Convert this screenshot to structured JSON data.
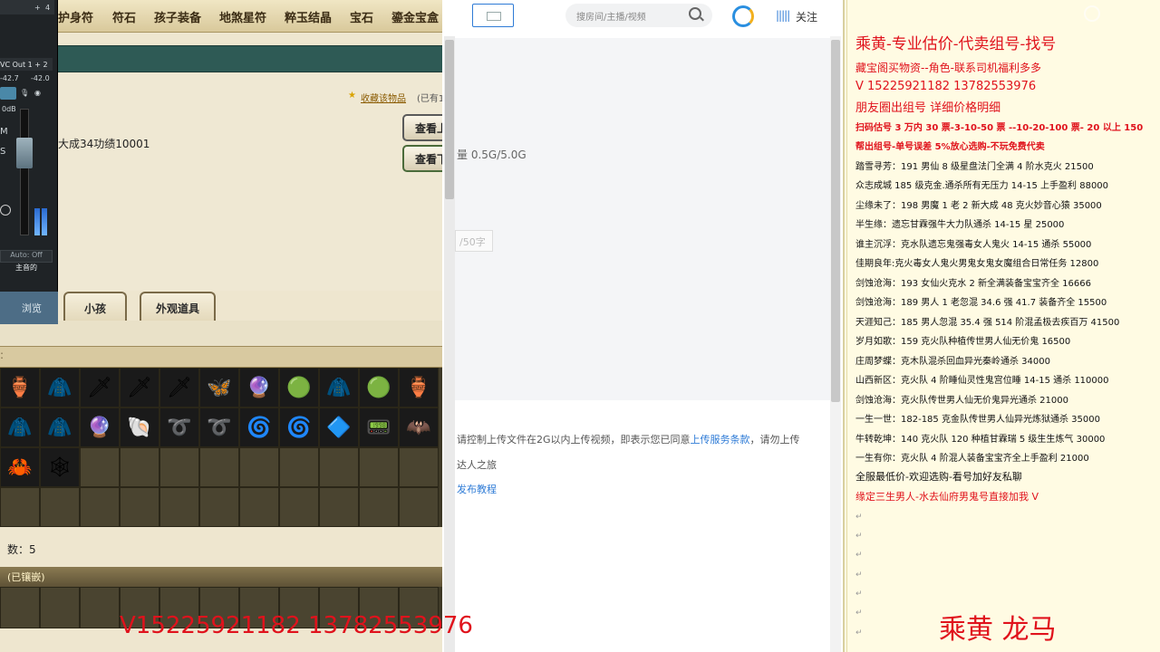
{
  "game": {
    "tabs": [
      "护身符",
      "符石",
      "孩子装备",
      "地煞星符",
      "粹玉结晶",
      "宝石",
      "鎏金宝盒"
    ],
    "favorite_link": "收藏该物品",
    "favorite_count": "(已有1",
    "achievement": "大成34功绩10001",
    "view_buttons": [
      "查看上",
      "查看下"
    ],
    "subtabs": [
      "小孩",
      "外观道具"
    ],
    "items_row1": [
      "🏺",
      "🧥",
      "🗡",
      "🗡",
      "🗡",
      "🦋",
      "🔮",
      "🟢",
      "🧥",
      "🟢",
      "🏺"
    ],
    "items_row2": [
      "🧥",
      "🧥",
      "🔮",
      "🐚",
      "➰",
      "➰",
      "🌀",
      "🌀",
      "🔷",
      "📟",
      "🦇"
    ],
    "items_row3": [
      "🦀",
      "🕸"
    ],
    "stones_label": "数：5",
    "gem_header": "(已镶嵌)"
  },
  "mixer": {
    "top_label": "+",
    "top_value": "4",
    "output": "VC Out 1 + 2",
    "db1": "-42.7",
    "db2": "-42.0",
    "gain": "0dB",
    "m": "M",
    "s": "S",
    "auto": "Auto: Off",
    "channel_name": "主音的",
    "browse": "浏览"
  },
  "web": {
    "search_placeholder": "搜房间/主播/视频",
    "follow_label": "关注",
    "storage": "量 0.5G/5.0G",
    "count_placeholder": "/50字",
    "notice_prefix": "请控制上传文件在2G以内上传视频，即表示您已同意",
    "notice_link": "上传服务条款",
    "notice_suffix": "，请勿上传",
    "notice2": "达人之旅",
    "tutorial": "发布教程"
  },
  "notes": {
    "title": "乘黄-专业估价-代卖组号-找号",
    "line2": "藏宝阁买物资--角色-联系司机福利多多",
    "line3": "V 15225921182    13782553976",
    "line4": "朋友圈出组号    详细价格明细",
    "line5": "扫码估号 3 万内 30 票-3-10-50 票  --10-20-100 票- 20 以上 150",
    "line6": "帮出组号-单号误差 5%放心选购-不玩免费代卖",
    "entries": [
      "踏雪寻芳：191 男仙 8 级星盘法门全满 4 阶水克火 21500",
      "众志成城  185 级克金.通杀所有无压力 14-15 上手盈利 88000",
      "尘缘未了：198 男魔 1 老 2 新大成 48 克火妙音心猿 35000",
      "半生缘：遗忘甘霖强牛大力队通杀 14-15 星 25000",
      "谁主沉浮：克水队遗忘鬼强毒女人鬼火 14-15 通杀 55000",
      "佳期良年:克火毒女人鬼火男鬼女鬼女魔组合日常任务 12800",
      "剑蚀沧海：193 女仙火克水 2 新全满装备宝宝齐全 16666",
      "剑蚀沧海：189 男人 1 老忽混 34.6 强 41.7 装备齐全 15500",
      "天涯知己：185 男人忽混 35.4 强 514 阶混孟极去疾百万 41500",
      "岁月如歌：159 克火队种植传世男人仙无价鬼 16500",
      "庄周梦蝶：克木队混杀回血异光秦岭通杀 34000",
      "山西新区：克火队 4 阶睡仙灵性鬼宫位睡 14-15 通杀 110000",
      "剑蚀沧海：克火队传世男人仙无价鬼异光通杀 21000",
      "一生一世：182-185 克金队传世男人仙异光炼狱通杀 35000",
      "牛转乾坤：140 克火队 120 种植甘霖瑞 5 级生生炼气 30000",
      "一生有你：克火队 4 阶混人装备宝宝齐全上手盈利 21000"
    ],
    "line_all": "全服最低价-欢迎选购-看号加好友私聊",
    "line_last": "缘定三生男人-水去仙府男鬼号直接加我 V",
    "return_mark": "↵"
  },
  "overlay": {
    "phones": "V15225921182   13782553976",
    "name": "乘黄  龙马"
  },
  "colors": {
    "accent_red": "#e0121c",
    "link_blue": "#2e7bd6",
    "game_teal": "#2e5a55"
  }
}
